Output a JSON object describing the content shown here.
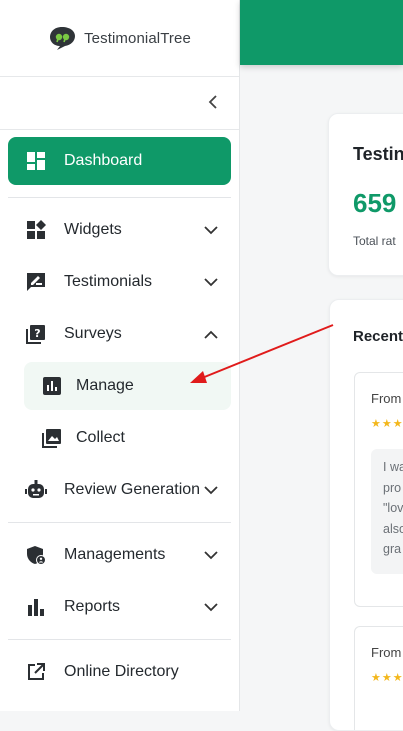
{
  "brand": {
    "name": "TestimonialTree"
  },
  "sidebar": {
    "items": [
      {
        "label": "Dashboard",
        "icon": "dashboard-icon"
      },
      {
        "label": "Widgets",
        "icon": "widgets-icon"
      },
      {
        "label": "Testimonials",
        "icon": "testimonials-icon"
      },
      {
        "label": "Surveys",
        "icon": "surveys-icon"
      },
      {
        "label": "Manage",
        "icon": "bar-chart-icon"
      },
      {
        "label": "Collect",
        "icon": "photo-icon"
      },
      {
        "label": "Review Generation",
        "icon": "robot-icon"
      },
      {
        "label": "Managements",
        "icon": "shield-user-icon"
      },
      {
        "label": "Reports",
        "icon": "bar-chart-icon"
      },
      {
        "label": "Online Directory",
        "icon": "external-link-icon"
      }
    ]
  },
  "main": {
    "stat_card": {
      "title": "Testin",
      "value": "659",
      "subtitle": "Total rat"
    },
    "recent_card": {
      "title": "Recent",
      "reviews": [
        {
          "from": "From",
          "stars": "★★★",
          "lines": [
            "I wa",
            "pro",
            "\"lov",
            "also",
            "gra"
          ]
        },
        {
          "from": "From",
          "stars": "★★★"
        }
      ]
    }
  },
  "colors": {
    "accent": "#0f9968",
    "star": "#f3b71c",
    "arrow": "#e01b1b"
  }
}
